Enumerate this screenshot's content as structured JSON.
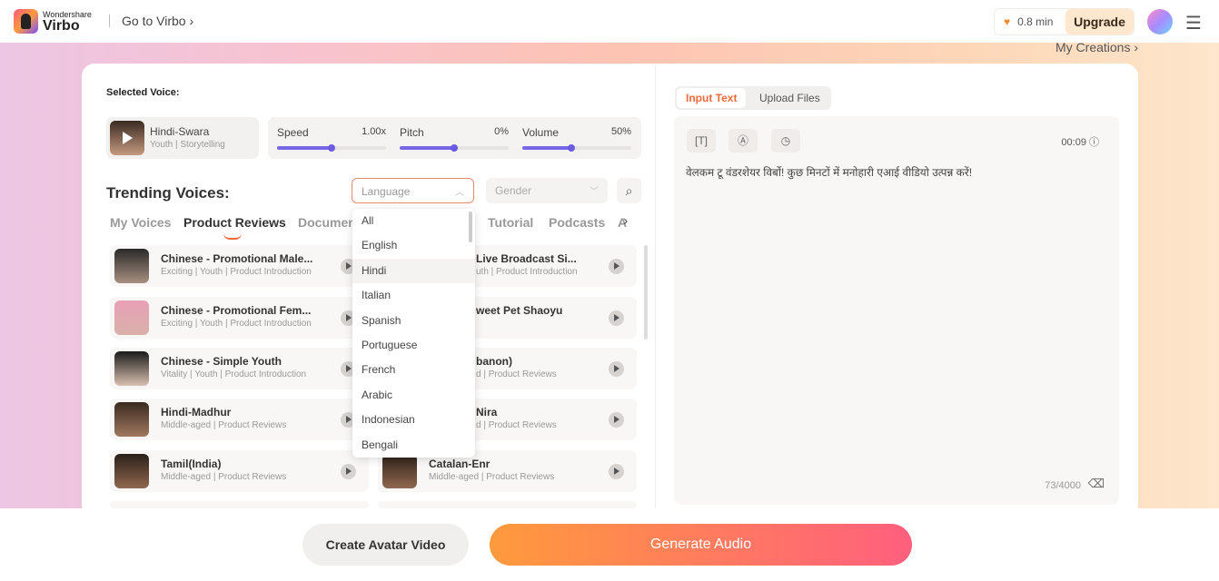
{
  "header": {
    "brand_small": "Wondershare",
    "brand_big": "Virbo",
    "goto": "Go to Virbo",
    "credits": "0.8 min",
    "upgrade": "Upgrade",
    "my_creations": "My Creations ›"
  },
  "selected": {
    "label": "Selected Voice:",
    "name": "Hindi-Swara",
    "tags": "Youth | Storytelling",
    "sliders": [
      {
        "name": "Speed",
        "value": "1.00x",
        "level": 0.5
      },
      {
        "name": "Pitch",
        "value": "0%",
        "level": 0.5
      },
      {
        "name": "Volume",
        "value": "50%",
        "level": 0.45
      }
    ]
  },
  "trending": {
    "title": "Trending Voices:",
    "language_placeholder": "Language",
    "gender_placeholder": "Gender",
    "tabs": [
      "My Voices",
      "Product Reviews",
      "Documen",
      "Tutorial",
      "Podcasts",
      "A"
    ],
    "voices_left": [
      {
        "name": "Chinese - Promotional Male...",
        "tags": "Exciting | Youth | Product Introduction"
      },
      {
        "name": "Chinese - Promotional Fem...",
        "tags": "Exciting | Youth | Product Introduction"
      },
      {
        "name": "Chinese - Simple Youth",
        "tags": "Vitality | Youth | Product Introduction"
      },
      {
        "name": "Hindi-Madhur",
        "tags": "Middle-aged | Product Reviews"
      },
      {
        "name": "Tamil(India)",
        "tags": "Middle-aged | Product Reviews"
      }
    ],
    "voices_right": [
      {
        "name": "Live Broadcast Si...",
        "tags": "uth | Product Introduction"
      },
      {
        "name": "weet Pet Shaoyu",
        "tags": ""
      },
      {
        "name": "banon)",
        "tags": "d | Product Reviews"
      },
      {
        "name": "Nira",
        "tags": "d | Product Reviews"
      },
      {
        "name": "Catalan-Enr",
        "tags": "Middle-aged | Product Reviews"
      }
    ]
  },
  "language_options": [
    "All",
    "English",
    "Hindi",
    "Italian",
    "Spanish",
    "Portuguese",
    "French",
    "Arabic",
    "Indonesian",
    "Bengali"
  ],
  "language_highlighted": "Hindi",
  "input": {
    "tabs": [
      "Input Text",
      "Upload Files"
    ],
    "duration": "00:09",
    "text": "वेलकम टू वंडरशेयर विर्बो! कुछ मिनटों में मनोहारी एआई वीडियो उत्पन्न करें!",
    "count": "73/4000"
  },
  "actions": {
    "avatar": "Create Avatar Video",
    "generate": "Generate Audio"
  },
  "colors": {
    "accent": "#ef6a3c",
    "slider": "#7567e6"
  }
}
